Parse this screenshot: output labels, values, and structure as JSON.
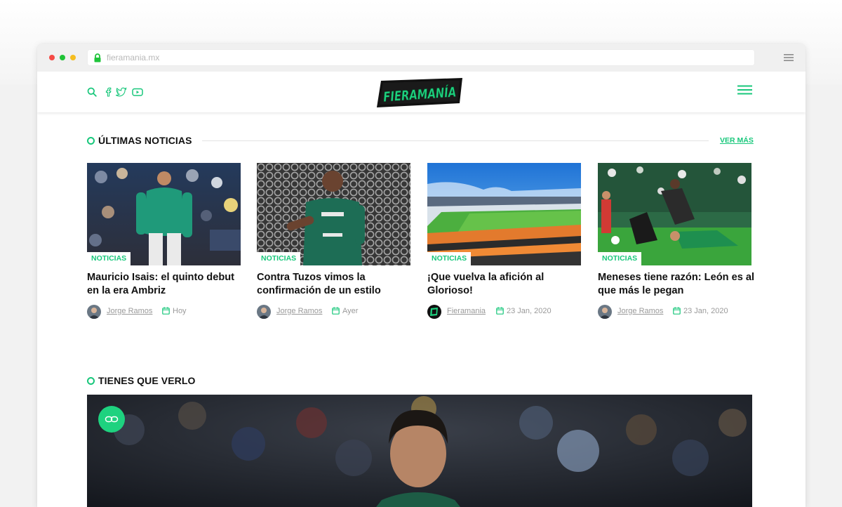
{
  "browser": {
    "url": "fieramania.mx",
    "icons": [
      "lock-icon",
      "menu-icon"
    ]
  },
  "header": {
    "logo_text": "FIERAMANÍA",
    "social_icons": [
      "search-icon",
      "facebook-icon",
      "twitter-icon",
      "youtube-icon"
    ],
    "menu_icon": "hamburger-icon"
  },
  "colors": {
    "accent": "#18c77b",
    "logo_green": "#1ed27f",
    "text": "#111111",
    "muted": "#9a9a9a"
  },
  "latest": {
    "section_title": "ÚLTIMAS NOTICIAS",
    "more_link": "VER MÁS",
    "cards": [
      {
        "tag": "NOTICIAS",
        "title": "Mauricio Isais: el quinto debut en la era Ambriz",
        "author": "Jorge Ramos",
        "date": "Hoy"
      },
      {
        "tag": "NOTICIAS",
        "title": "Contra Tuzos vimos la confirmación de un estilo",
        "author": "Jorge Ramos",
        "date": "Ayer"
      },
      {
        "tag": "NOTICIAS",
        "title": "¡Que vuelva la afición al Glorioso!",
        "author": "Fieramania",
        "date": "23 Jan, 2020"
      },
      {
        "tag": "NOTICIAS",
        "title": "Meneses tiene razón: León es al que más le pegan",
        "author": "Jorge Ramos",
        "date": "23 Jan, 2020"
      }
    ]
  },
  "must_see": {
    "section_title": "TIENES QUE VERLO",
    "link_icon": "link-icon"
  }
}
